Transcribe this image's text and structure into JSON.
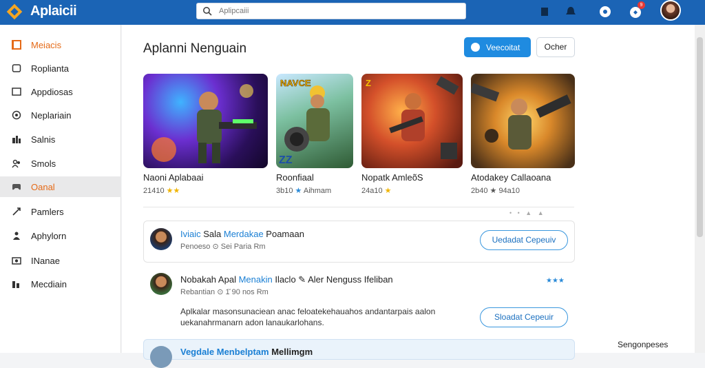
{
  "app": {
    "brand": "Aplaicii"
  },
  "search": {
    "placeholder": "Aplipcaiii"
  },
  "topbar": {
    "badge": "9"
  },
  "sidebar": {
    "items": [
      {
        "label": "Meiacis",
        "icon": "folder-icon"
      },
      {
        "label": "Roplianta",
        "icon": "document-icon"
      },
      {
        "label": "Appdiosas",
        "icon": "window-icon"
      },
      {
        "label": "Neplariain",
        "icon": "chat-icon"
      },
      {
        "label": "Salnis",
        "icon": "grid-icon"
      },
      {
        "label": "Smols",
        "icon": "people-icon"
      },
      {
        "label": "Oanal",
        "icon": "game-icon"
      },
      {
        "label": "Pamlers",
        "icon": "share-icon"
      },
      {
        "label": "Aphylorn",
        "icon": "person-icon"
      },
      {
        "label": "INanae",
        "icon": "camera-icon"
      },
      {
        "label": "Mecdiain",
        "icon": "chart-icon"
      }
    ]
  },
  "main": {
    "title": "Aplanni Nenguain",
    "primary_button": "Veecoitat",
    "secondary_button": "Ocher",
    "cards": [
      {
        "title": "Naoni Aplabaai",
        "meta": "21410"
      },
      {
        "title": "Roonfiaal",
        "meta": "3b10",
        "meta2": "Aihmam"
      },
      {
        "title": "Nopatk AmleõS",
        "meta": "24a10"
      },
      {
        "title": "Atodakey Callaoana",
        "meta": "2b40 ★ 94a10"
      }
    ],
    "list": [
      {
        "title_a": "Iviaic",
        "title_b": " Sala ",
        "title_c": "Merdakae",
        "title_d": " Poamaan",
        "sub": "Penoeso ⊙ Sei Paria Rm",
        "button": "Uedadat Cepeuiv"
      },
      {
        "title_a": "Nobakah Apal ",
        "title_b": "Menakin",
        "title_c": " Ilaclo ",
        "title_d": "Aler Nenguss Ifeliban",
        "sub": "Rebantian ⊙ 1̆ 90 nos Rm",
        "desc_line1": "Aplkalar masonsunaciean anac feloatekehauahos andantarpais aalon",
        "desc_line2": "uekanahrmanarn adon lanaukarlohans.",
        "button": "Sloadat Cepeuir"
      },
      {
        "title_a": "Vegdale",
        "title_b": " Menbelptam ",
        "title_c": "Mellimgm"
      }
    ],
    "footer_right": "Sengonpeses"
  }
}
